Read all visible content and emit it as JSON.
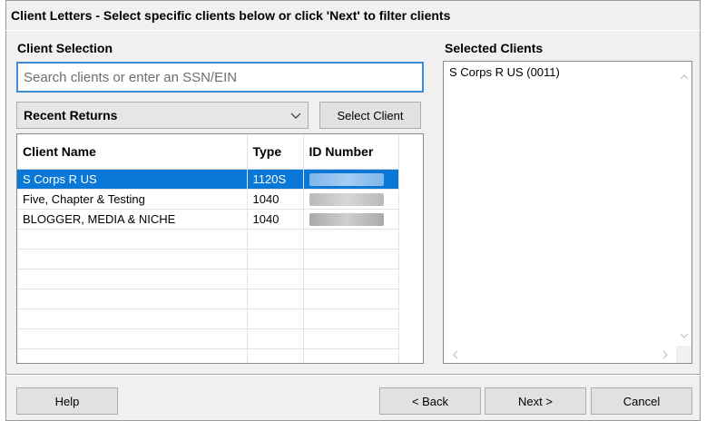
{
  "header": {
    "title": "Client Letters - Select specific clients below or click 'Next' to filter clients"
  },
  "client_selection": {
    "label": "Client Selection",
    "search": {
      "placeholder": "Search clients or enter an SSN/EIN",
      "value": ""
    },
    "dropdown": {
      "selected": "Recent Returns",
      "icon": "chevron-down-icon"
    },
    "select_client_button": "Select Client",
    "table": {
      "columns": [
        "Client Name",
        "Type",
        "ID Number"
      ],
      "rows": [
        {
          "name": "S Corps R US",
          "type": "1120S",
          "id": "",
          "selected": true
        },
        {
          "name": "Five, Chapter & Testing",
          "type": "1040",
          "id": "",
          "selected": false
        },
        {
          "name": "BLOGGER, MEDIA & NICHE",
          "type": "1040",
          "id": "",
          "selected": false
        }
      ],
      "id_note": "ID numbers are blurred/redacted"
    }
  },
  "selected_clients": {
    "label": "Selected Clients",
    "items": [
      "S Corps R US (0011)"
    ]
  },
  "footer": {
    "help": "Help",
    "back": "< Back",
    "next": "Next >",
    "cancel": "Cancel"
  },
  "colors": {
    "selection": "#0a78d7",
    "focus_border": "#3c8ed8",
    "dialog_bg": "#f0f0f0"
  }
}
